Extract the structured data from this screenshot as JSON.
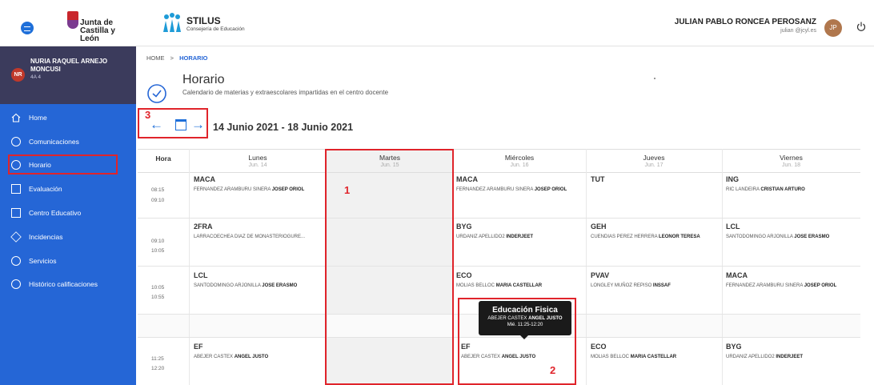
{
  "header": {
    "jcyl_logo_text": "Junta de\nCastilla y León",
    "app_name": "STILUS",
    "app_subtitle": "Consejería de Educación",
    "user_name": "JULIAN PABLO RONCEA PEROSANZ",
    "user_email": "julian @jcyl.es",
    "user_initials": "JP",
    "icons": [
      "menu-icon",
      "power-icon"
    ]
  },
  "sidebar": {
    "profile": {
      "initials": "NR",
      "name": "NURIA RAQUEL ARNEJO MONCUSI",
      "group": "4A 4"
    },
    "items": [
      {
        "label": "Home",
        "icon": "home-icon"
      },
      {
        "label": "Comunicaciones",
        "icon": "chat-icon"
      },
      {
        "label": "Horario",
        "icon": "clock-icon",
        "active": true
      },
      {
        "label": "Evaluación",
        "icon": "grade-icon"
      },
      {
        "label": "Centro Educativo",
        "icon": "building-icon"
      },
      {
        "label": "Incidencias",
        "icon": "diamond-icon"
      },
      {
        "label": "Servicios",
        "icon": "gear-icon"
      },
      {
        "label": "Histórico calificaciones",
        "icon": "history-icon"
      }
    ]
  },
  "breadcrumb": {
    "home": "HOME",
    "sep": ">",
    "current": "HORARIO"
  },
  "page": {
    "title": "Horario",
    "subtitle": "Calendario de materias y extraescolares impartidas en el centro docente"
  },
  "week": {
    "range": "14 Junio 2021 - 18 Junio 2021"
  },
  "annotations": {
    "step1": "1",
    "step2": "2",
    "step3": "3"
  },
  "timetable": {
    "hora_label": "Hora",
    "days": [
      {
        "name": "Lunes",
        "date": "Jun. 14"
      },
      {
        "name": "Martes",
        "date": "Jun. 15"
      },
      {
        "name": "Miércoles",
        "date": "Jun. 16"
      },
      {
        "name": "Jueves",
        "date": "Jun. 17"
      },
      {
        "name": "Viernes",
        "date": "Jun. 18"
      }
    ],
    "rows": [
      {
        "start": "08:15",
        "end": "09:10",
        "lunes": {
          "subject": "MACA",
          "teacher": "FERNANDEZ ARAMBURU SINERA",
          "teacher_first": "JOSEP ORIOL"
        },
        "miercoles": {
          "subject": "MACA",
          "teacher": "FERNANDEZ ARAMBURU SINERA",
          "teacher_first": "JOSEP ORIOL"
        },
        "jueves": {
          "subject": "TUT",
          "teacher": "",
          "teacher_first": ""
        },
        "viernes": {
          "subject": "ING",
          "teacher": "RIC LANDEIRA",
          "teacher_first": "CRISTIAN ARTURO"
        }
      },
      {
        "start": "09:10",
        "end": "10:05",
        "lunes": {
          "subject": "2FRA",
          "teacher": "LARRACOECHEA DIAZ DE MONASTERIOGURE...",
          "teacher_first": ""
        },
        "miercoles": {
          "subject": "BYG",
          "teacher": "URDANIZ APELLIDO2",
          "teacher_first": "INDERJEET"
        },
        "jueves": {
          "subject": "GEH",
          "teacher": "CUENDIAS PEREZ HERRERA",
          "teacher_first": "LEONOR TERESA"
        },
        "viernes": {
          "subject": "LCL",
          "teacher": "SANTODOMINGO ARJONILLA",
          "teacher_first": "JOSE ERASMO"
        }
      },
      {
        "start": "10:05",
        "end": "10:55",
        "lunes": {
          "subject": "LCL",
          "teacher": "SANTODOMINGO ARJONILLA",
          "teacher_first": "JOSE ERASMO"
        },
        "miercoles": {
          "subject": "ECO",
          "teacher": "MOLIAS BELLOC",
          "teacher_first": "MARIA CASTELLAR"
        },
        "jueves": {
          "subject": "PVAV",
          "teacher": "LONGLEY MUÑOZ REPISO",
          "teacher_first": "INSSAF"
        },
        "viernes": {
          "subject": "MACA",
          "teacher": "FERNANDEZ ARAMBURU SINERA",
          "teacher_first": "JOSEP ORIOL"
        }
      },
      {
        "start": "11:25",
        "end": "12:20",
        "lunes": {
          "subject": "EF",
          "teacher": "ABEJER CASTEX",
          "teacher_first": "ANGEL JUSTO"
        },
        "miercoles": {
          "subject": "EF",
          "teacher": "ABEJER CASTEX",
          "teacher_first": "ANGEL JUSTO"
        },
        "jueves": {
          "subject": "ECO",
          "teacher": "MOLIAS BELLOC",
          "teacher_first": "MARIA CASTELLAR"
        },
        "viernes": {
          "subject": "BYG",
          "teacher": "URDANIZ APELLIDO2",
          "teacher_first": "INDERJEET"
        }
      }
    ]
  },
  "tooltip": {
    "title": "Educación Fisica",
    "teacher": "ABEJER CASTEX",
    "teacher_first": "ANGEL JUSTO",
    "time": "Mié. 11:25-12:20"
  },
  "colors": {
    "sidebar": "#2566d6",
    "profile_bg": "#3b3b5c",
    "accent": "#1e6fd9",
    "highlight": "#e0242b"
  }
}
